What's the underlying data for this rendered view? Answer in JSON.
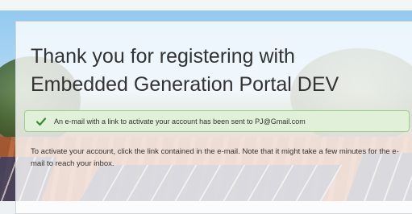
{
  "page": {
    "title_line1": "Thank you for registering with",
    "title_line2": "Embedded Generation Portal DEV",
    "alert": {
      "message": "An e-mail with a link to activate your account has been sent to PJ@Gmail.com",
      "icon": "check-icon",
      "status_color": "#3c8a2e"
    },
    "info_text": "To activate your account, click the link contained in the e-mail. Note that it might take a few minutes for the e-mail to reach your inbox."
  }
}
